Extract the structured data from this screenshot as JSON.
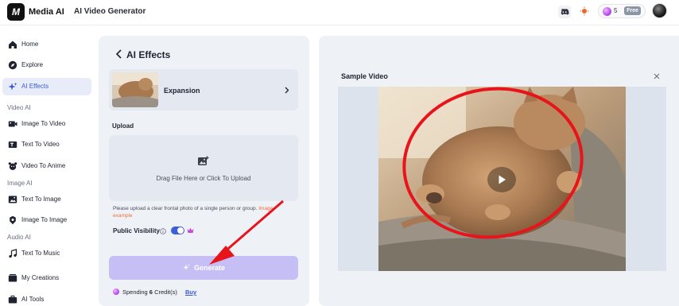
{
  "header": {
    "brand": "Media AI",
    "app_title": "AI Video Generator",
    "credits": "5",
    "plan_badge": "Free",
    "logo_text": "M"
  },
  "sidebar": {
    "top_items": [
      {
        "label": "Home",
        "icon": "home-icon"
      },
      {
        "label": "Explore",
        "icon": "compass-icon"
      },
      {
        "label": "AI Effects",
        "icon": "sparkle-icon",
        "active": true
      }
    ],
    "sections": [
      {
        "title": "Video AI",
        "items": [
          {
            "label": "Image To Video",
            "icon": "image-video-icon"
          },
          {
            "label": "Text To Video",
            "icon": "text-video-icon"
          },
          {
            "label": "Video To Anime",
            "icon": "anime-icon"
          }
        ]
      },
      {
        "title": "Image AI",
        "items": [
          {
            "label": "Text To Image",
            "icon": "text-image-icon"
          },
          {
            "label": "Image To Image",
            "icon": "image-image-icon"
          }
        ]
      },
      {
        "title": "Audio AI",
        "items": [
          {
            "label": "Text To Music",
            "icon": "music-icon"
          }
        ]
      }
    ],
    "bottom_items": [
      {
        "label": "My Creations",
        "icon": "creations-icon"
      },
      {
        "label": "AI Tools",
        "icon": "tools-icon"
      }
    ]
  },
  "effects_panel": {
    "title": "AI Effects",
    "selected_effect": "Expansion",
    "upload_label": "Upload",
    "upload_prompt": "Drag File Here or Click To Upload",
    "hint": "Please upload a clear frontal photo of a single person or group.",
    "hint_link": "Image example",
    "visibility_label": "Public Visibility",
    "visibility_on": true,
    "generate_label": "Generate",
    "spending_prefix": "Spending",
    "spending_amount": "6",
    "spending_suffix": "Credit(s)",
    "buy_label": "Buy"
  },
  "sample_panel": {
    "title": "Sample Video"
  },
  "colors": {
    "accent": "#3d5ddb",
    "generate_disabled": "#c6bff5",
    "annotation_red": "#e8141b",
    "hint_link": "#f26d3d"
  }
}
